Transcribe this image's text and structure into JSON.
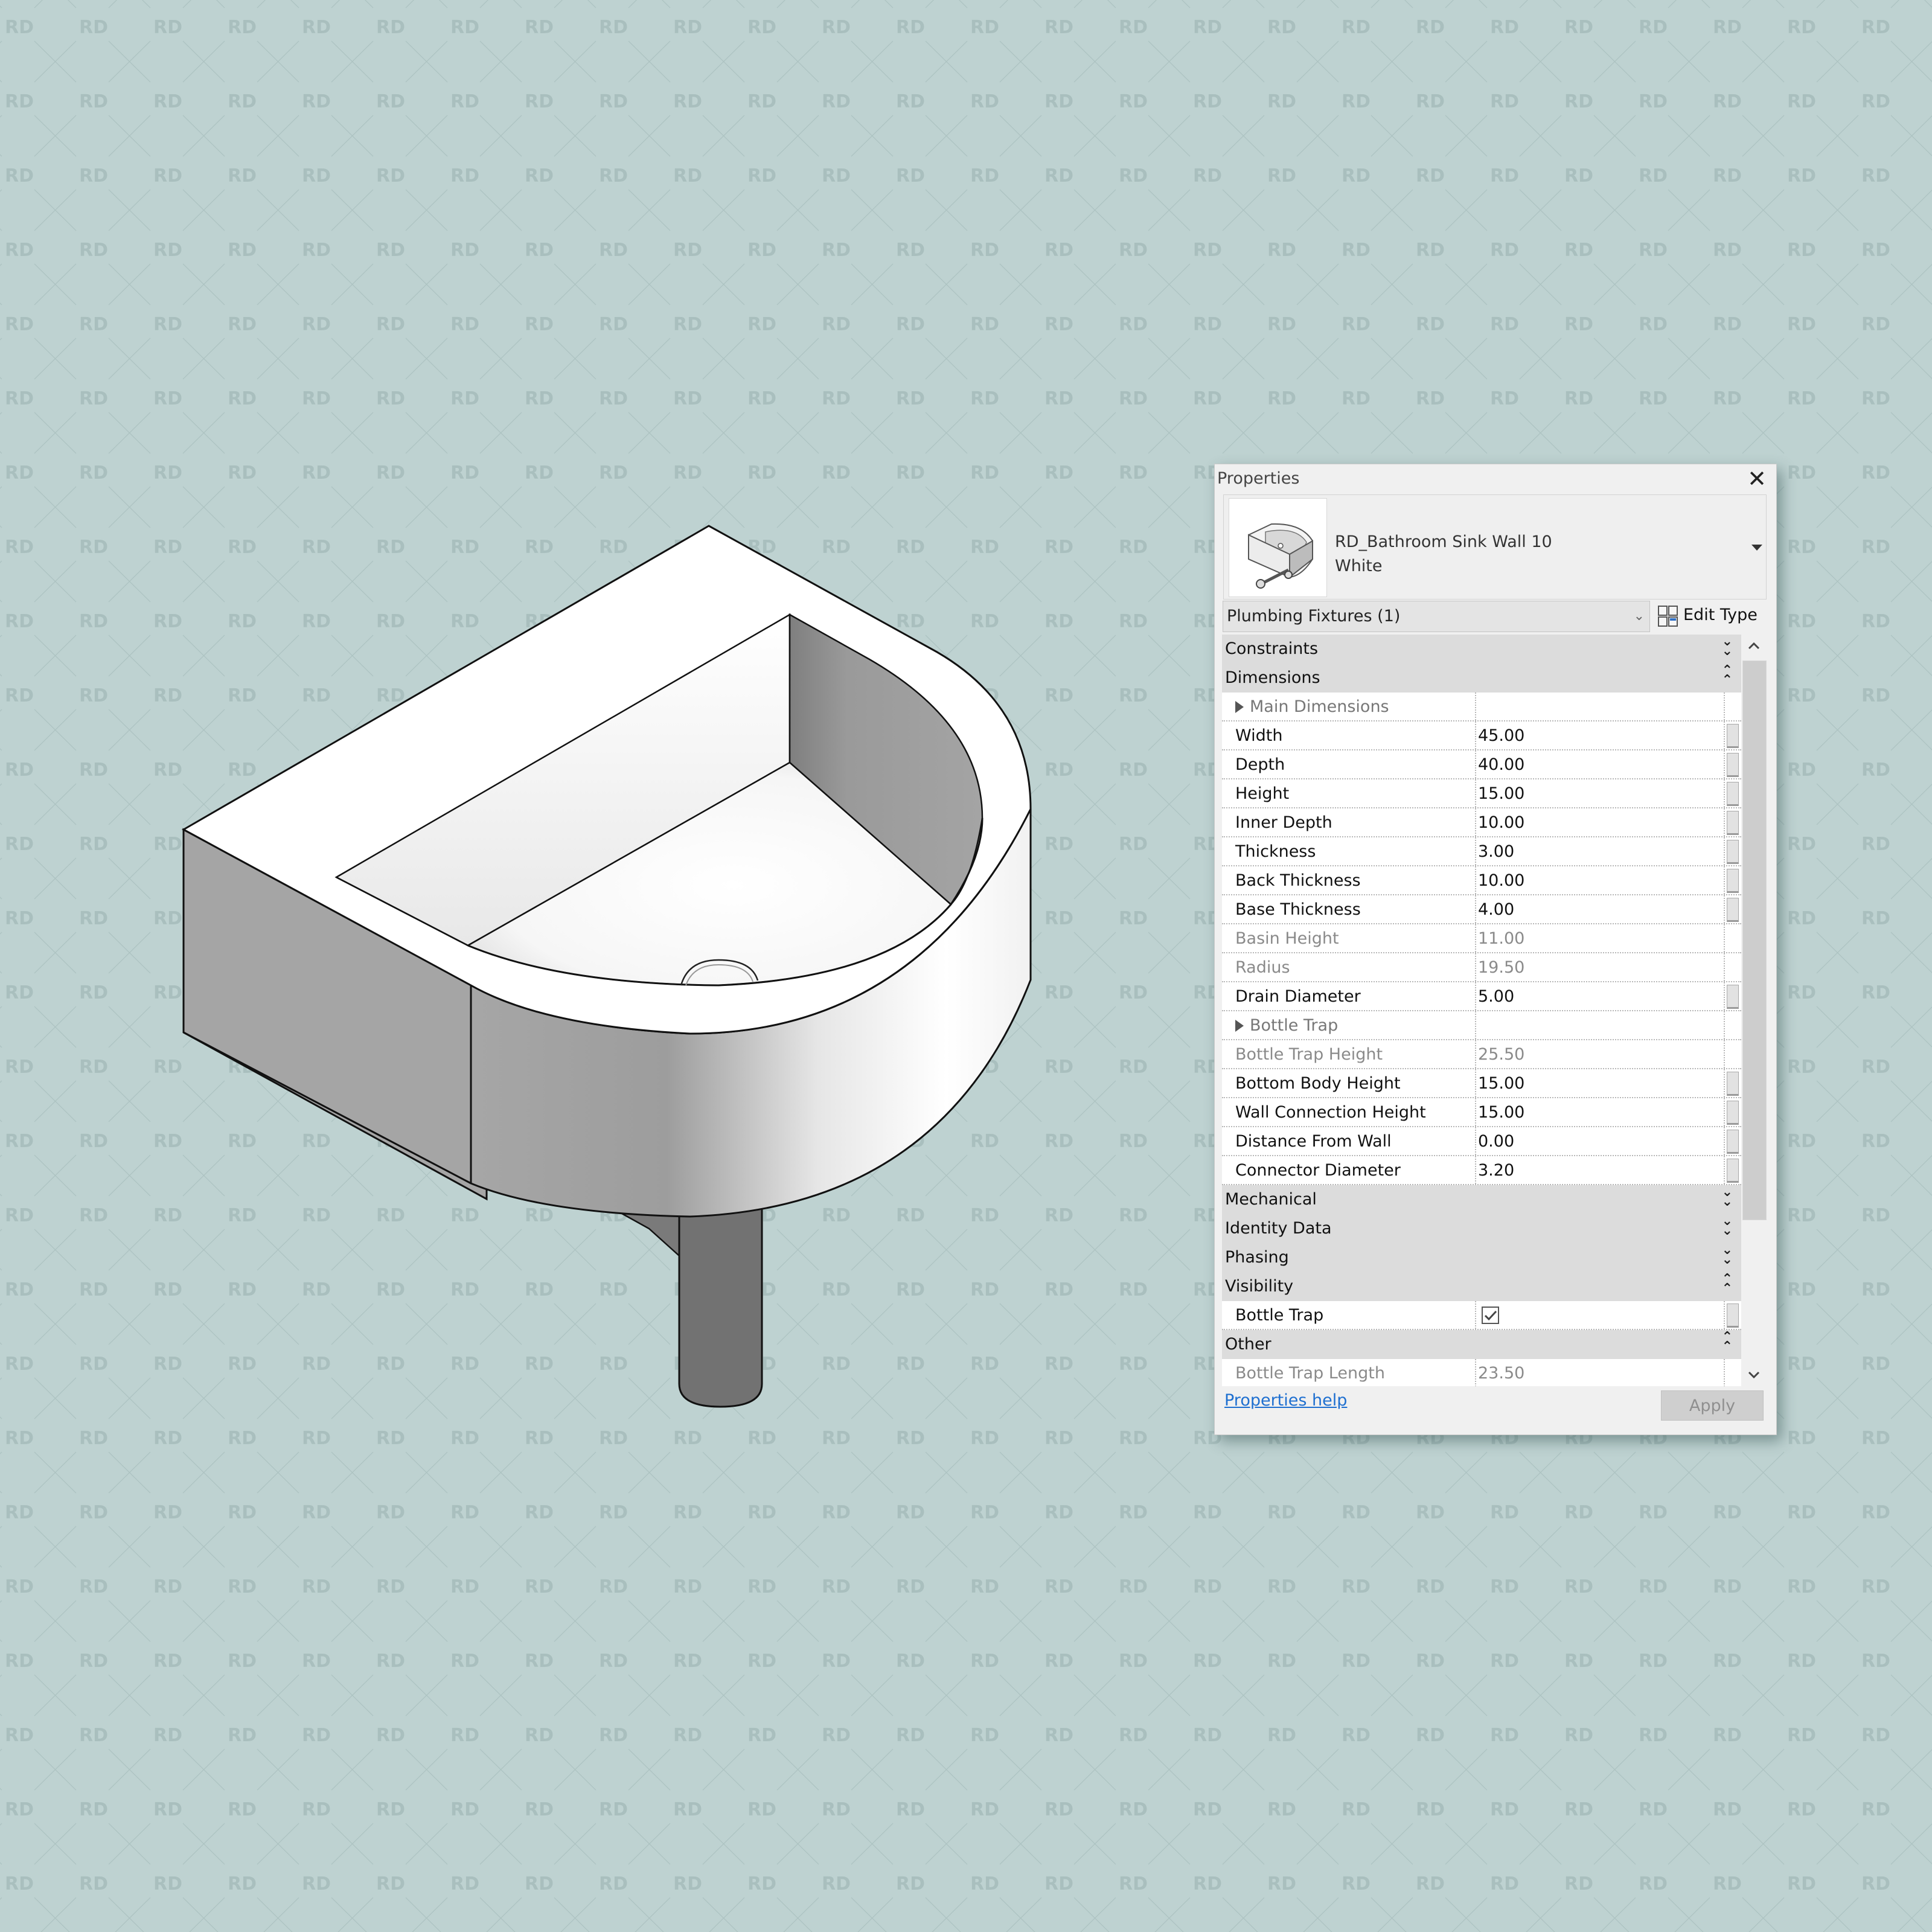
{
  "colors": {
    "background": "#bed2d1",
    "watermark": "#a9bfbe",
    "panel": "#f0f0f0",
    "section_band": "#dcdcdc",
    "link": "#1e6fd0",
    "pipe": "#727272"
  },
  "watermark": {
    "text": "RD"
  },
  "model": {
    "description": "Isometric view of wall-mounted D-shaped bathroom sink with bottle trap pipe"
  },
  "properties_panel": {
    "title": "Properties",
    "close_icon": "close-icon",
    "type_selector": {
      "name_line1": "RD_Bathroom Sink Wall 10",
      "name_line2": "White"
    },
    "instance_filter": "Plumbing Fixtures (1)",
    "edit_type_label": "Edit Type",
    "sections": [
      {
        "label": "Constraints",
        "expanded": false
      },
      {
        "label": "Dimensions",
        "expanded": true,
        "rows": [
          {
            "type": "group",
            "label": "Main Dimensions"
          },
          {
            "label": "Width",
            "value": "45.00",
            "editable": true
          },
          {
            "label": "Depth",
            "value": "40.00",
            "editable": true
          },
          {
            "label": "Height",
            "value": "15.00",
            "editable": true
          },
          {
            "label": "Inner Depth",
            "value": "10.00",
            "editable": true
          },
          {
            "label": "Thickness",
            "value": "3.00",
            "editable": true
          },
          {
            "label": "Back Thickness",
            "value": "10.00",
            "editable": true
          },
          {
            "label": "Base Thickness",
            "value": "4.00",
            "editable": true
          },
          {
            "label": "Basin Height",
            "value": "11.00",
            "editable": false
          },
          {
            "label": "Radius",
            "value": "19.50",
            "editable": false
          },
          {
            "label": "Drain Diameter",
            "value": "5.00",
            "editable": true
          },
          {
            "type": "group",
            "label": "Bottle Trap"
          },
          {
            "label": "Bottle Trap Height",
            "value": "25.50",
            "editable": false
          },
          {
            "label": "Bottom Body Height",
            "value": "15.00",
            "editable": true
          },
          {
            "label": "Wall Connection Height",
            "value": "15.00",
            "editable": true
          },
          {
            "label": "Distance From Wall",
            "value": "0.00",
            "editable": true
          },
          {
            "label": "Connector Diameter",
            "value": "3.20",
            "editable": true
          }
        ]
      },
      {
        "label": "Mechanical",
        "expanded": false
      },
      {
        "label": "Identity Data",
        "expanded": false
      },
      {
        "label": "Phasing",
        "expanded": false
      },
      {
        "label": "Visibility",
        "expanded": true,
        "rows": [
          {
            "label": "Bottle Trap",
            "checkbox": true,
            "checked": true,
            "editable": true
          }
        ]
      },
      {
        "label": "Other",
        "expanded": true,
        "rows": [
          {
            "label": "Bottle Trap Length",
            "value": "23.50",
            "editable": false
          }
        ]
      }
    ],
    "help_link": "Properties help",
    "apply_label": "Apply"
  }
}
